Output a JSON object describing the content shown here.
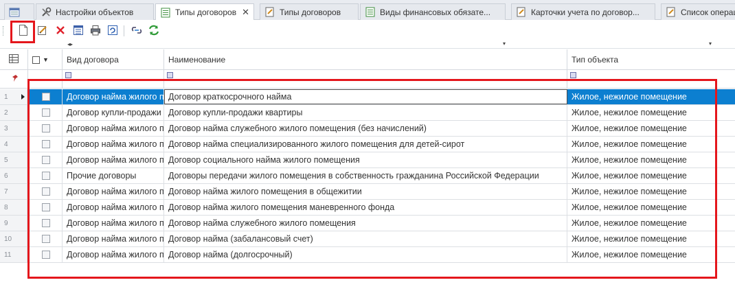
{
  "tabs": [
    {
      "label": "",
      "icon": "window-icon",
      "active": false
    },
    {
      "label": "Настройки объектов",
      "icon": "tools-icon",
      "active": false
    },
    {
      "label": "Типы договоров",
      "icon": "table-icon",
      "active": true,
      "close": "✕"
    },
    {
      "label": "Типы договоров",
      "icon": "edit-doc-icon",
      "active": false
    },
    {
      "label": "Виды финансовых обязате...",
      "icon": "table-icon",
      "active": false
    },
    {
      "label": "Карточки учета по договор...",
      "icon": "edit-doc-icon",
      "active": false
    },
    {
      "label": "Список операц",
      "icon": "edit-doc-icon",
      "active": false
    }
  ],
  "toolbar": {
    "buttons": [
      "new-document-icon",
      "edit-icon",
      "delete-icon",
      "columns-icon",
      "print-icon",
      "refresh-view-icon",
      "link-icon",
      "reload-icon"
    ],
    "highlighted": "new-document-icon"
  },
  "grid": {
    "columns": [
      "Вид договора",
      "Наименование",
      "Тип объекта"
    ],
    "rows": [
      {
        "n": "1",
        "vid": "Договор найма жилого помещения",
        "name": "Договор краткосрочного найма",
        "type": "Жилое, нежилое помещение"
      },
      {
        "n": "2",
        "vid": "Договор купли-продажи",
        "name": "Договор купли-продажи квартиры",
        "type": "Жилое, нежилое помещение"
      },
      {
        "n": "3",
        "vid": "Договор найма жилого помещения",
        "name": "Договор найма служебного жилого помещения (без начислений)",
        "type": "Жилое, нежилое помещение"
      },
      {
        "n": "4",
        "vid": "Договор найма жилого помещения",
        "name": "Договор найма специализированного жилого помещения для детей-сирот",
        "type": "Жилое, нежилое помещение"
      },
      {
        "n": "5",
        "vid": "Договор найма жилого помещения",
        "name": "Договор социального найма жилого помещения",
        "type": "Жилое, нежилое помещение"
      },
      {
        "n": "6",
        "vid": "Прочие договоры",
        "name": "Договоры передачи жилого помещения в собственность гражданина Российской Федерации",
        "type": "Жилое, нежилое помещение"
      },
      {
        "n": "7",
        "vid": "Договор найма жилого помещения",
        "name": "Договор найма жилого помещения в общежитии",
        "type": "Жилое, нежилое помещение"
      },
      {
        "n": "8",
        "vid": "Договор найма жилого помещения",
        "name": "Договор найма жилого помещения маневренного фонда",
        "type": "Жилое, нежилое помещение"
      },
      {
        "n": "9",
        "vid": "Договор найма жилого помещения",
        "name": "Договор найма служебного жилого помещения",
        "type": "Жилое, нежилое помещение"
      },
      {
        "n": "10",
        "vid": "Договор найма жилого помещения",
        "name": "Договор найма (забалансовый счет)",
        "type": "Жилое, нежилое помещение"
      },
      {
        "n": "11",
        "vid": "Договор найма жилого помещения",
        "name": "Договор найма (долгосрочный)",
        "type": "Жилое, нежилое помещение"
      }
    ],
    "selected_row": "1"
  },
  "colors": {
    "selection": "#0c7fd0",
    "highlight": "#e4161c"
  }
}
